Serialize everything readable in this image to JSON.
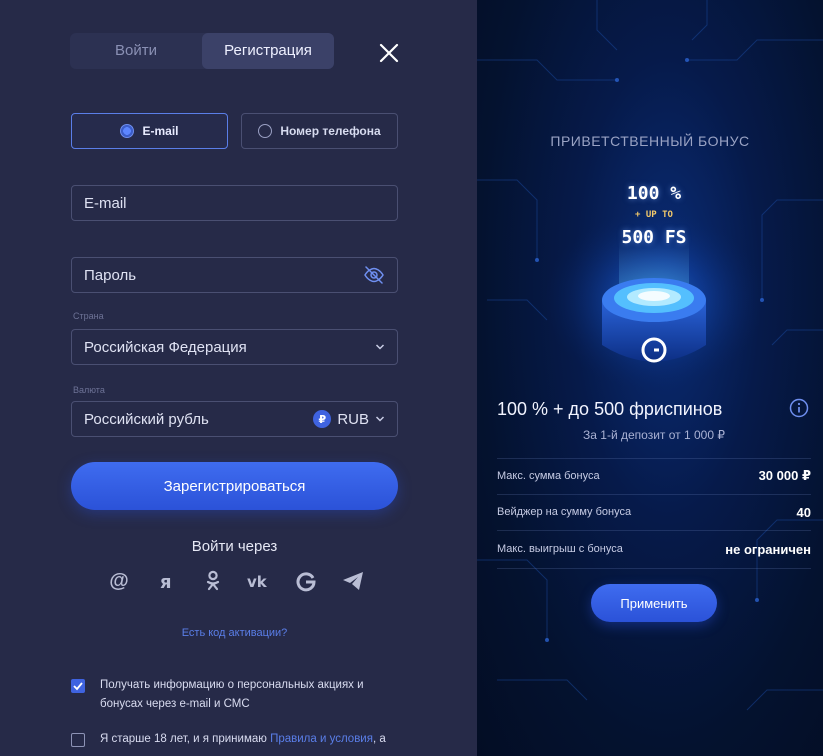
{
  "auth_tabs": {
    "login": "Войти",
    "register": "Регистрация"
  },
  "method": {
    "email": "E-mail",
    "phone": "Номер телефона",
    "selected": "email"
  },
  "form": {
    "email_placeholder": "E-mail",
    "password_placeholder": "Пароль",
    "country_label": "Страна",
    "country_value": "Российская Федерация",
    "currency_label": "Валюта",
    "currency_value": "Российский рубль",
    "currency_symbol": "₽",
    "currency_code": "RUB"
  },
  "register_button": "Зарегистрироваться",
  "login_via": "Войти через",
  "social_icons": [
    "mail-icon",
    "yandex-icon",
    "odnoklassniki-icon",
    "vk-icon",
    "google-icon",
    "telegram-icon"
  ],
  "activation_link": "Есть код активации?",
  "consents": {
    "marketing": {
      "text": "Получать информацию о персональных акциях и бонусах через e-mail и СМС",
      "checked": true
    },
    "age": {
      "text_before": "Я старше 18 лет, и я принимаю ",
      "link": "Правила и условия",
      "text_after": ", а",
      "checked": false
    }
  },
  "bonus": {
    "heading": "ПРИВЕТСТВЕННЫЙ БОНУС",
    "promo_line1": "100 %",
    "promo_line2": "+ UP TO",
    "promo_line3": "500 FS",
    "title": "100 % + до 500 фриспинов",
    "subtitle": "За 1-й депозит от 1 000 ₽",
    "rows": [
      {
        "label": "Макс. сумма бонуса",
        "value": "30 000 ₽"
      },
      {
        "label": "Вейджер на сумму бонуса",
        "value": "40"
      },
      {
        "label": "Макс. выигрыш с бонуса",
        "value": "не ограничен"
      }
    ],
    "apply_button": "Применить"
  },
  "colors": {
    "accent": "#3f63e0",
    "panel_bg": "#262a48",
    "link": "#5a7ee8"
  }
}
